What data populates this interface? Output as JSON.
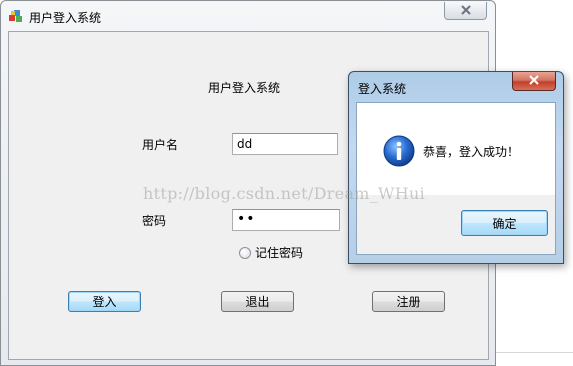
{
  "main_window": {
    "title": "用户登入系统",
    "form_title": "用户登入系统",
    "username_label": "用户名",
    "username_value": "dd",
    "password_label": "密码",
    "password_value": "••",
    "remember_label": "记住密码",
    "remember_checked": false,
    "buttons": {
      "login": "登入",
      "exit": "退出",
      "register": "注册"
    }
  },
  "message_box": {
    "title": "登入系统",
    "message": "恭喜，登入成功！",
    "ok_label": "确定",
    "icon": "info-icon"
  },
  "watermark": "http://blog.csdn.net/Dream_WHui",
  "colors": {
    "accent_button_border": "#3c7fb1",
    "close_button_red": "#c0402a",
    "dialog_frame": "#b6cfe7",
    "info_icon_blue": "#1f5fbf"
  }
}
